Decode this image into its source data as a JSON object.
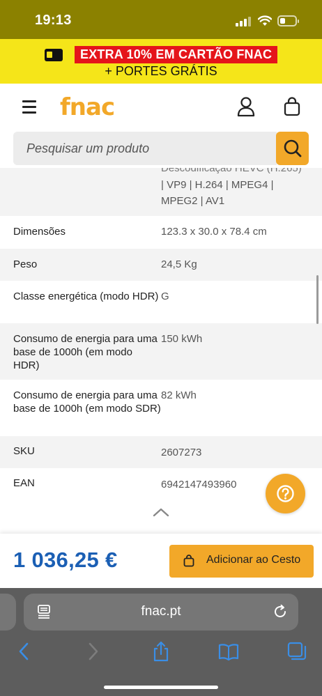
{
  "status": {
    "time": "19:13"
  },
  "promo": {
    "line1": "EXTRA 10% EM CARTÃO FNAC",
    "line2": "+ PORTES GRÁTIS"
  },
  "header": {
    "logo": "fnac"
  },
  "search": {
    "placeholder": "Pesquisar um produto"
  },
  "specs": {
    "cut_value": "Descodificação HEVC (H.265)",
    "rows": [
      {
        "label": "",
        "value": "| VP9 | H.264 | MPEG4 | MPEG2 | AV1"
      },
      {
        "label": "Dimensões",
        "value": "123.3 x 30.0 x 78.4 cm"
      },
      {
        "label": "Peso",
        "value": "24,5 Kg"
      },
      {
        "label": "Classe energética (modo HDR)",
        "value": "G"
      },
      {
        "label": "Consumo de energia para uma base de 1000h (em modo HDR)",
        "value": "150 kWh"
      },
      {
        "label": "Consumo de energia para uma base de 1000h (em modo SDR)",
        "value": "82 kWh"
      },
      {
        "label": "SKU",
        "value": "2607273"
      },
      {
        "label": "EAN",
        "value": "6942147493960"
      }
    ]
  },
  "buy": {
    "price": "1 036,25 €",
    "add_label": "Adicionar ao Cesto"
  },
  "browser": {
    "url": "fnac.pt"
  },
  "colors": {
    "accent": "#f2a829",
    "price": "#1b5fb4",
    "promo_bg": "#f5e519",
    "promo_red": "#e5141b",
    "status_bg": "#8b8100",
    "ios_blue": "#3a8ee6"
  }
}
